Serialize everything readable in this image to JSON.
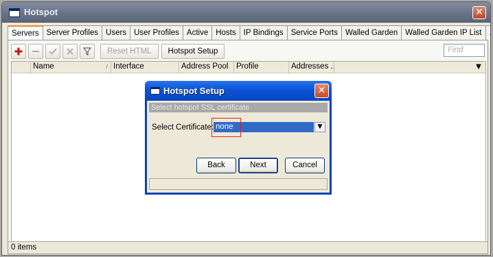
{
  "window": {
    "title": "Hotspot",
    "close_label": "✕"
  },
  "tabs": [
    {
      "label": "Servers",
      "active": true
    },
    {
      "label": "Server Profiles"
    },
    {
      "label": "Users"
    },
    {
      "label": "User Profiles"
    },
    {
      "label": "Active"
    },
    {
      "label": "Hosts"
    },
    {
      "label": "IP Bindings"
    },
    {
      "label": "Service Ports"
    },
    {
      "label": "Walled Garden"
    },
    {
      "label": "Walled Garden IP List"
    },
    {
      "label": "..."
    }
  ],
  "toolbar": {
    "add_icon": "plus-icon",
    "remove_icon": "minus-icon",
    "enable_icon": "check-icon",
    "disable_icon": "x-icon",
    "filter_icon": "filter-icon",
    "reset_html_label": "Reset HTML",
    "hotspot_setup_label": "Hotspot Setup",
    "find_placeholder": "Find"
  },
  "table": {
    "columns": [
      "",
      "Name",
      "Interface",
      "Address Pool",
      "Profile",
      "Addresses ..."
    ],
    "sort_indicator": "/",
    "dropdown_arrow": "▼"
  },
  "status": {
    "items_count": "0 items"
  },
  "dialog": {
    "title": "Hotspot Setup",
    "close_label": "✕",
    "header": "Select hotspot SSL certificate",
    "field_label": "Select Certificate:",
    "field_value": "none",
    "dropdown_arrow": "▼",
    "back_label": "Back",
    "next_label": "Next",
    "cancel_label": "Cancel"
  },
  "colors": {
    "accent": "#316ac5",
    "dialog_title": "#0a53d6",
    "highlight": "#e02020"
  }
}
